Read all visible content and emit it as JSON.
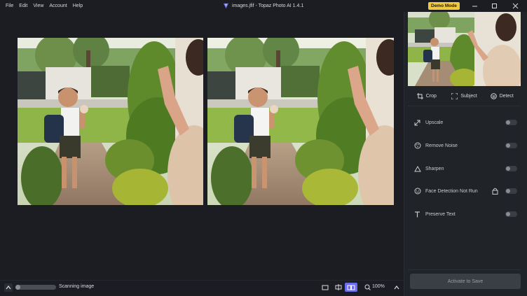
{
  "menu": [
    "File",
    "Edit",
    "View",
    "Account",
    "Help"
  ],
  "window_title": "images.jfif - Topaz Photo AI 1.4.1",
  "demo_badge": "Demo Mode",
  "thumbnail_actions": [
    {
      "label": "Crop",
      "icon": "crop-icon"
    },
    {
      "label": "Subject",
      "icon": "subject-icon"
    },
    {
      "label": "Detect",
      "icon": "detect-icon"
    }
  ],
  "features": [
    {
      "label": "Upscale",
      "icon": "upscale-icon",
      "enabled": false
    },
    {
      "label": "Remove Noise",
      "icon": "remove-noise-icon",
      "enabled": false
    },
    {
      "label": "Sharpen",
      "icon": "sharpen-icon",
      "enabled": false
    },
    {
      "label": "Face Detection Not Run",
      "icon": "face-icon",
      "enabled": false,
      "locked": true
    },
    {
      "label": "Preserve Text",
      "icon": "text-icon",
      "enabled": false
    }
  ],
  "activate_button": "Activate to Save",
  "status": {
    "scan_text": "Scanning image",
    "progress": 0.1
  },
  "view_modes": [
    "single",
    "split",
    "side-by-side"
  ],
  "active_view": "side-by-side",
  "zoom": "100%",
  "colors": {
    "accent": "#6a6cf2",
    "demo_badge": "#f0c940",
    "background": "#1b1d22",
    "sidebar": "#202328"
  }
}
